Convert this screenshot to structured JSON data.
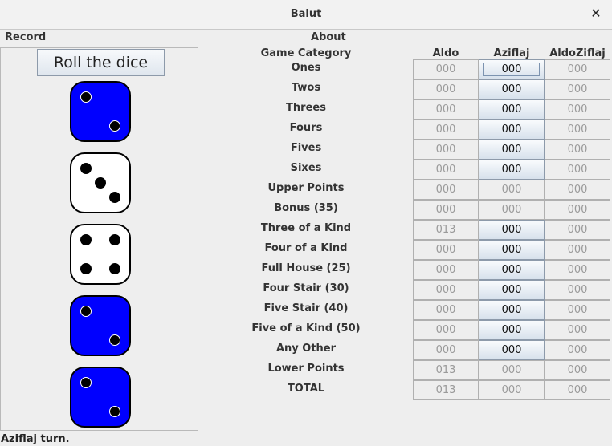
{
  "window": {
    "title": "Balut",
    "close_glyph": "✕"
  },
  "menu": {
    "record": "Record",
    "about": "About"
  },
  "roll_button": "Roll the dice",
  "dice": [
    {
      "color": "blue",
      "value": 2
    },
    {
      "color": "white",
      "value": 3
    },
    {
      "color": "white",
      "value": 4
    },
    {
      "color": "blue",
      "value": 2
    },
    {
      "color": "blue",
      "value": 2
    }
  ],
  "table": {
    "category_header": "Game Category",
    "players": [
      "Aldo",
      "Aziflaj",
      "AldoZiflaj"
    ],
    "active_player": 1,
    "rows": [
      {
        "category": "Ones",
        "values": [
          "000",
          "000",
          "000"
        ],
        "clickable": true
      },
      {
        "category": "Twos",
        "values": [
          "000",
          "000",
          "000"
        ],
        "clickable": true
      },
      {
        "category": "Threes",
        "values": [
          "000",
          "000",
          "000"
        ],
        "clickable": true
      },
      {
        "category": "Fours",
        "values": [
          "000",
          "000",
          "000"
        ],
        "clickable": true
      },
      {
        "category": "Fives",
        "values": [
          "000",
          "000",
          "000"
        ],
        "clickable": true
      },
      {
        "category": "Sixes",
        "values": [
          "000",
          "000",
          "000"
        ],
        "clickable": true
      },
      {
        "category": "Upper Points",
        "values": [
          "000",
          "000",
          "000"
        ],
        "clickable": false
      },
      {
        "category": "Bonus (35)",
        "values": [
          "000",
          "000",
          "000"
        ],
        "clickable": false
      },
      {
        "category": "Three of a Kind",
        "values": [
          "013",
          "000",
          "000"
        ],
        "clickable": true
      },
      {
        "category": "Four of a Kind",
        "values": [
          "000",
          "000",
          "000"
        ],
        "clickable": true
      },
      {
        "category": "Full House (25)",
        "values": [
          "000",
          "000",
          "000"
        ],
        "clickable": true
      },
      {
        "category": "Four Stair (30)",
        "values": [
          "000",
          "000",
          "000"
        ],
        "clickable": true
      },
      {
        "category": "Five Stair (40)",
        "values": [
          "000",
          "000",
          "000"
        ],
        "clickable": true
      },
      {
        "category": "Five of a Kind (50)",
        "values": [
          "000",
          "000",
          "000"
        ],
        "clickable": true
      },
      {
        "category": "Any Other",
        "values": [
          "000",
          "000",
          "000"
        ],
        "clickable": true
      },
      {
        "category": "Lower Points",
        "values": [
          "013",
          "000",
          "000"
        ],
        "clickable": false
      },
      {
        "category": "TOTAL",
        "values": [
          "013",
          "000",
          "000"
        ],
        "clickable": false
      }
    ]
  },
  "status": "Aziflaj turn.",
  "colors": {
    "die_blue": "#0000ff",
    "die_white": "#ffffff",
    "pip": "#000000"
  }
}
